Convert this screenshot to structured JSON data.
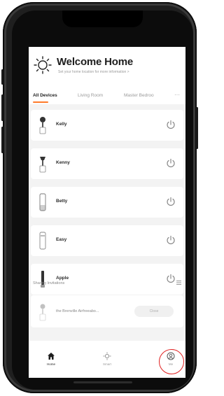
{
  "header": {
    "title": "Welcome Home",
    "subtitle": "Set your home location for more information >"
  },
  "tabs": [
    {
      "label": "All Devices",
      "active": true
    },
    {
      "label": "Living Room",
      "active": false
    },
    {
      "label": "Master Bedroo",
      "active": false
    }
  ],
  "tabs_more": "···",
  "devices": [
    {
      "name": "Kelly",
      "icon": "lamp-icon"
    },
    {
      "name": "Kenny",
      "icon": "lamp-icon"
    },
    {
      "name": "Betty",
      "icon": "bottle-icon"
    },
    {
      "name": "Easy",
      "icon": "bottle-icon"
    },
    {
      "name": "Apple",
      "icon": "tube-icon"
    }
  ],
  "shared": {
    "label": "Sharing Invitations",
    "device_name": "the Brenville Airfreeabo...",
    "button_label": "Close"
  },
  "nav": [
    {
      "label": "Home",
      "icon": "house-icon",
      "active": true
    },
    {
      "label": "Smart",
      "icon": "sun-scene-icon",
      "active": false
    },
    {
      "label": "Me",
      "icon": "person-circle-icon",
      "active": false
    }
  ],
  "colors": {
    "accent": "#ff7a2a",
    "highlight": "#e02020",
    "list_background": "#f3f3f3"
  }
}
